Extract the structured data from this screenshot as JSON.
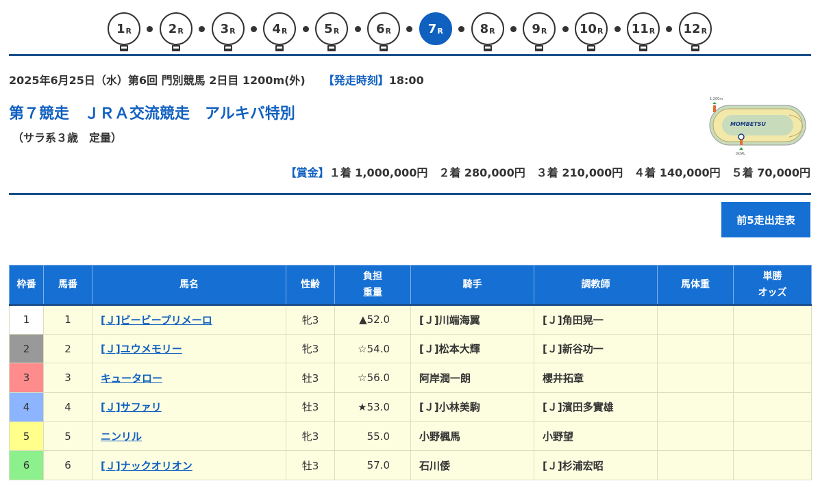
{
  "race_nav": {
    "races": [
      {
        "num": "1",
        "r": "R"
      },
      {
        "num": "2",
        "r": "R"
      },
      {
        "num": "3",
        "r": "R"
      },
      {
        "num": "4",
        "r": "R"
      },
      {
        "num": "5",
        "r": "R"
      },
      {
        "num": "6",
        "r": "R"
      },
      {
        "num": "7",
        "r": "R"
      },
      {
        "num": "8",
        "r": "R"
      },
      {
        "num": "9",
        "r": "R"
      },
      {
        "num": "10",
        "r": "R"
      },
      {
        "num": "11",
        "r": "R"
      },
      {
        "num": "12",
        "r": "R"
      }
    ],
    "active_race": "7"
  },
  "race_info": {
    "date_line": "2025年6月25日（水）第6回 門別競馬 2日目 1200m(外)",
    "post_time_label": "【発走時刻】",
    "post_time": "18:00",
    "title": "第７競走　ＪＲＡ交流競走　アルキバ特別",
    "conditions": "（サラ系３歳　定量）"
  },
  "course_map": {
    "track_name": "MOMBETSU",
    "start_label": "1,200m",
    "goal_label": "GOAL"
  },
  "prize": {
    "label": "【賞金】",
    "text": "１着 1,000,000円　２着 280,000円　３着 210,000円　４着 140,000円　５着 70,000円"
  },
  "past5_button": "前5走出走表",
  "table": {
    "headers": {
      "waku": "枠番",
      "umaban": "馬番",
      "name": "馬名",
      "sex_age": "性齢",
      "weight_1": "負担",
      "weight_2": "重量",
      "jockey": "騎手",
      "trainer": "調教師",
      "body_weight": "馬体重",
      "odds_1": "単勝",
      "odds_2": "オッズ"
    },
    "rows": [
      {
        "waku": "1",
        "waku_color": "#ffffff",
        "umaban": "1",
        "name": "[Ｊ]ビービープリメーロ",
        "sex_age": "牝3",
        "weight": "▲52.0",
        "jockey": "[Ｊ]川端海翼",
        "trainer": "[Ｊ]角田晃一",
        "body_weight": "",
        "odds": ""
      },
      {
        "waku": "2",
        "waku_color": "#999999",
        "umaban": "2",
        "name": "[Ｊ]ユウメモリー",
        "sex_age": "牝3",
        "weight": "☆54.0",
        "jockey": "[Ｊ]松本大輝",
        "trainer": "[Ｊ]新谷功一",
        "body_weight": "",
        "odds": ""
      },
      {
        "waku": "3",
        "waku_color": "#ff8c8c",
        "umaban": "3",
        "name": "キュータロー",
        "sex_age": "牡3",
        "weight": "☆56.0",
        "jockey": "阿岸潤一朗",
        "trainer": "櫻井拓章",
        "body_weight": "",
        "odds": ""
      },
      {
        "waku": "4",
        "waku_color": "#8cb4ff",
        "umaban": "4",
        "name": "[Ｊ]サファリ",
        "sex_age": "牡3",
        "weight": "★53.0",
        "jockey": "[Ｊ]小林美駒",
        "trainer": "[Ｊ]濱田多實雄",
        "body_weight": "",
        "odds": ""
      },
      {
        "waku": "5",
        "waku_color": "#ffff8c",
        "umaban": "5",
        "name": "ニンリル",
        "sex_age": "牝3",
        "weight": "55.0",
        "jockey": "小野楓馬",
        "trainer": "小野望",
        "body_weight": "",
        "odds": ""
      },
      {
        "waku": "6",
        "waku_color": "#8cf08c",
        "umaban": "6",
        "name": "[Ｊ]ナックオリオン",
        "sex_age": "牡3",
        "weight": "57.0",
        "jockey": "石川倭",
        "trainer": "[Ｊ]杉浦宏昭",
        "body_weight": "",
        "odds": ""
      }
    ]
  }
}
